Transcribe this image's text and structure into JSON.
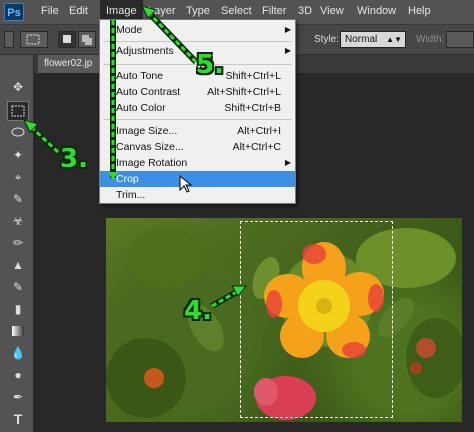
{
  "app": {
    "logo": "Ps"
  },
  "menubar": {
    "items": [
      "File",
      "Edit",
      "Image",
      "Layer",
      "Type",
      "Select",
      "Filter",
      "3D",
      "View",
      "Window",
      "Help"
    ]
  },
  "options": {
    "style_label": "Style:",
    "style_value": "Normal",
    "width_label": "Width:"
  },
  "document": {
    "tab": "flower02.jp"
  },
  "image_menu": {
    "items": [
      {
        "label": "Mode",
        "shortcut": "",
        "submenu": true
      },
      {
        "label": "Adjustments",
        "shortcut": "",
        "submenu": true
      },
      {
        "label": "Auto Tone",
        "shortcut": "Shift+Ctrl+L"
      },
      {
        "label": "Auto Contrast",
        "shortcut": "Alt+Shift+Ctrl+L"
      },
      {
        "label": "Auto Color",
        "shortcut": "Shift+Ctrl+B"
      },
      {
        "label": "Image Size...",
        "shortcut": "Alt+Ctrl+I"
      },
      {
        "label": "Canvas Size...",
        "shortcut": "Alt+Ctrl+C"
      },
      {
        "label": "Image Rotation",
        "shortcut": "",
        "submenu": true
      },
      {
        "label": "Crop",
        "shortcut": "",
        "highlighted": true
      },
      {
        "label": "Trim...",
        "shortcut": ""
      }
    ]
  },
  "annotations": {
    "step3": "3.",
    "step4": "4.",
    "step5": "5."
  },
  "colors": {
    "highlight": "#3d8fe6",
    "annotation": "#2fdc2f"
  },
  "toolbar": {
    "tools": [
      "move-icon",
      "marquee-icon",
      "lasso-icon",
      "magic-wand-icon",
      "crop-icon",
      "eyedropper-icon",
      "healing-icon",
      "brush-icon",
      "stamp-icon",
      "history-brush-icon",
      "eraser-icon",
      "gradient-icon",
      "blur-icon",
      "dodge-icon",
      "pen-icon",
      "type-icon"
    ]
  }
}
